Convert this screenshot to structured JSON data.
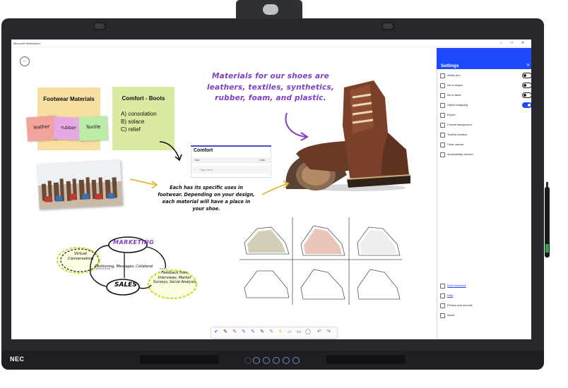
{
  "brand": "NEC",
  "window": {
    "title": "Microsoft Whiteboard",
    "minimize": "–",
    "maximize": "□",
    "close": "✕"
  },
  "canvas": {
    "back_icon": "arrow-left-icon",
    "note_materials": {
      "title": "Footwear Materials",
      "items": [
        "leather",
        "rubber",
        "Textile"
      ]
    },
    "note_boots": {
      "title": "Comfort - Boots",
      "lines": [
        "A) consolation",
        "B) solace",
        "C) relief"
      ]
    },
    "comfort_card": {
      "title": "Comfort",
      "col_task": "Task",
      "col_likes": "Likes",
      "input_placeholder": "Type here..."
    },
    "headline": "Materials for our shoes are leathers, textiles, synthetics, rubber, foam, and plastic.",
    "note_text": "Each has its specific uses in footwear. Depending on your design, each material will have a place in your shoe.",
    "mindmap": {
      "marketing": "MARKETING",
      "sales": "SALES",
      "virtual": "Virtual Conversation",
      "positioning": "Positioning, Messages, Collateral",
      "feedback": "Feedback from Interviews, Market Surveys, Social Analysis"
    }
  },
  "settings": {
    "title": "Settings",
    "close_icon": "close-icon",
    "toggles": [
      {
        "label": "Active pen",
        "on": false
      },
      {
        "label": "Ink to shape",
        "on": false
      },
      {
        "label": "Ink to table",
        "on": false
      },
      {
        "label": "Object snapping",
        "on": true
      }
    ],
    "items": [
      "Export",
      "Format background",
      "Toolbar location",
      "Clear canvas",
      "Accessibility checker"
    ],
    "links": [
      "Send feedback",
      "Help"
    ],
    "footer": [
      "Privacy and security",
      "About"
    ]
  },
  "toolbar": {
    "tools": [
      "select-icon",
      "pen-black-icon",
      "pen-red-icon",
      "pen-blue-icon",
      "pen-purple-icon",
      "pen-dark-icon",
      "pen-gray-icon",
      "highlighter-icon",
      "eraser-icon",
      "ruler-icon",
      "lasso-icon",
      "undo-icon",
      "redo-icon"
    ],
    "colors": [
      "#2b6cf0",
      "#111111",
      "#d23b3b",
      "#2e5fd8",
      "#7b3fc4",
      "#333333",
      "#777777",
      "#e3d43b",
      "#c86a2e"
    ]
  },
  "colors": {
    "accent": "#1f48ff",
    "headline": "#7f3fc4",
    "sticky_yellow": "#f7dea1",
    "sticky_green": "#d9eba0"
  }
}
